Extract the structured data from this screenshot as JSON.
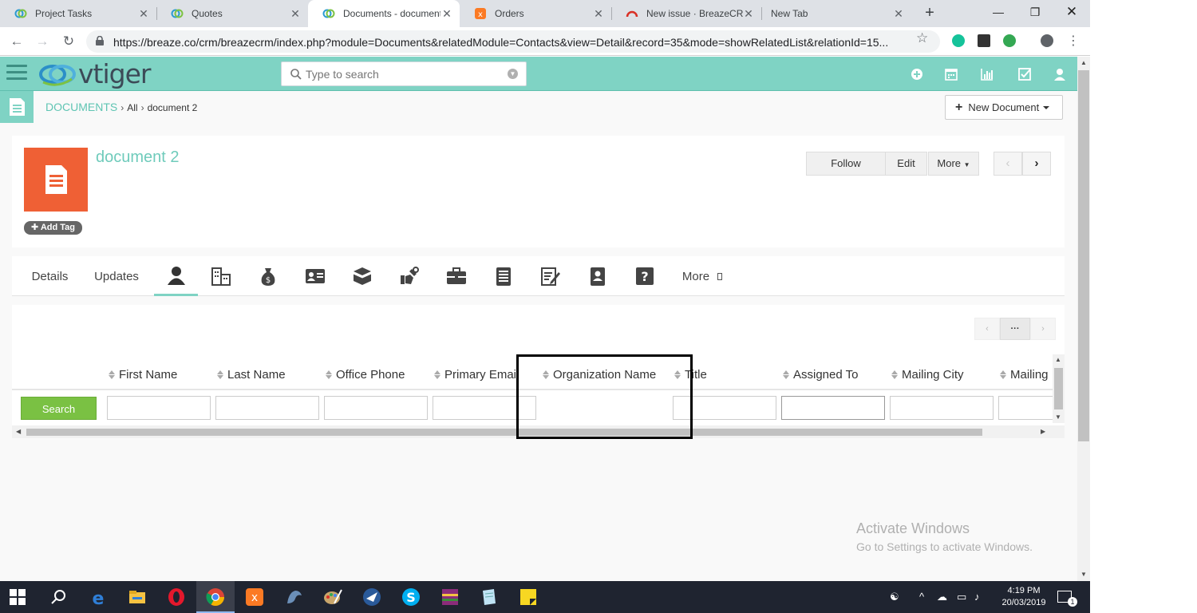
{
  "browser": {
    "tabs": [
      {
        "title": "Project Tasks"
      },
      {
        "title": "Quotes"
      },
      {
        "title": "Documents - document"
      },
      {
        "title": "Orders"
      },
      {
        "title": "New issue · BreazeCRM"
      },
      {
        "title": "New Tab"
      }
    ],
    "url": "https://breaze.co/crm/breazecrm/index.php?module=Documents&relatedModule=Contacts&view=Detail&record=35&mode=showRelatedList&relationId=15..."
  },
  "header": {
    "logo_text": "vtiger",
    "search_placeholder": "Type to search"
  },
  "breadcrumb": {
    "module": "DOCUMENTS",
    "filter": "All",
    "record": "document 2"
  },
  "new_document_label": "New Document",
  "record": {
    "title": "document 2",
    "add_tag_label": "Add Tag",
    "actions": {
      "follow": "Follow",
      "edit": "Edit",
      "more": "More"
    }
  },
  "related_tabs": {
    "details": "Details",
    "updates": "Updates",
    "icons": [
      "contacts-icon",
      "organizations-icon",
      "deals-icon",
      "leads-icon",
      "products-icon",
      "services-icon",
      "projects-icon",
      "invoices-icon",
      "quotes-icon",
      "vendors-icon",
      "faq-icon"
    ],
    "more": "More"
  },
  "related_list": {
    "pager_label": "···",
    "columns": [
      "First Name",
      "Last Name",
      "Office Phone",
      "Primary Email",
      "Organization Name",
      "Title",
      "Assigned To",
      "Mailing City",
      "Mailing"
    ],
    "search_label": "Search"
  },
  "watermark": {
    "title": "Activate Windows",
    "subtitle": "Go to Settings to activate Windows."
  },
  "taskbar": {
    "time": "4:19 PM",
    "date": "20/03/2019",
    "notification_count": "1"
  },
  "colors": {
    "accent": "#7fd3c4",
    "record_icon": "#ef6035",
    "search_button": "#7ac143"
  }
}
